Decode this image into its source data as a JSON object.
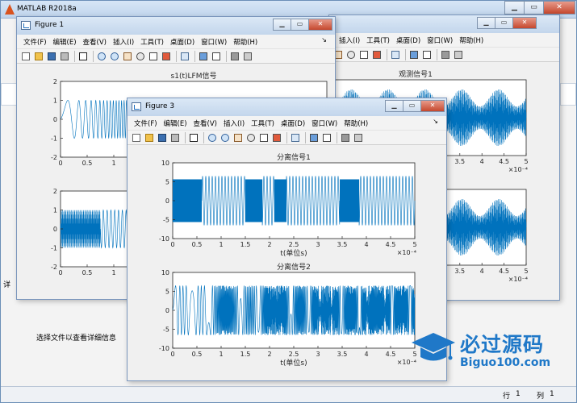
{
  "main_window": {
    "title": "MATLAB R2018a",
    "detail_hint": "选择文件以查看详细信息",
    "status_row_label": "行",
    "status_row_value": "1",
    "status_col_label": "列",
    "status_col_value": "1",
    "side_tab_label": "详"
  },
  "menu": [
    "文件(F)",
    "编辑(E)",
    "查看(V)",
    "插入(I)",
    "工具(T)",
    "桌面(D)",
    "窗口(W)",
    "帮助(H)"
  ],
  "fig2_menu_visible": [
    "插入(I)",
    "工具(T)",
    "桌面(D)",
    "窗口(W)",
    "帮助(H)"
  ],
  "toolbar_icons": [
    "new-figure-icon",
    "open-file-icon",
    "save-icon",
    "print-icon",
    "pointer-icon",
    "zoom-in-icon",
    "zoom-out-icon",
    "pan-hand-icon",
    "rotate-3d-icon",
    "data-cursor-icon",
    "brush-icon",
    "link-plot-icon",
    "colorbar-icon",
    "legend-icon",
    "hide-plot-tools-icon",
    "show-plot-tools-icon"
  ],
  "colors": {
    "line": "#0072bd",
    "accent": "#d9531e",
    "watermark": "#1f78c8"
  },
  "figures": {
    "figure1": {
      "title": "Figure 1",
      "plot1_title": "s1(t)LFM信号",
      "plot2_title": ""
    },
    "figure2": {
      "title_visible": "",
      "plot1_title": "观测信号1",
      "exp_label": "×10⁻⁴"
    },
    "figure3": {
      "title": "Figure 3",
      "plot1_title": "分离信号1",
      "plot1_xlabel": "t(单位s)",
      "plot2_title": "分离信号2",
      "plot2_xlabel": "t(单位s)",
      "exp_label": "×10⁻⁴"
    }
  },
  "chart_data": [
    {
      "type": "line",
      "title": "s1(t)LFM信号",
      "xlabel": "",
      "ylabel": "",
      "x_ticks_visible": [
        "0",
        "0.5",
        "1"
      ],
      "y_ticks": [
        "-2",
        "-1",
        "0",
        "1",
        "2"
      ],
      "xlim": [
        0,
        0.0005
      ],
      "ylim": [
        -2,
        2
      ],
      "grid": false,
      "series": [
        {
          "description_hint": "linear chirp amplitude 1",
          "amplitude": 1
        }
      ]
    },
    {
      "type": "line",
      "title": "",
      "x_ticks_visible": [
        "0",
        "0.5",
        "1"
      ],
      "y_ticks": [
        "-2",
        "-1",
        "0",
        "1",
        "2"
      ],
      "xlim": [
        0,
        0.0005
      ],
      "ylim": [
        -2,
        2
      ],
      "series": [
        {
          "amplitude": 1
        }
      ]
    },
    {
      "type": "line",
      "title": "观测信号1",
      "x_ticks_visible": [
        "3.5",
        "4",
        "4.5",
        "5"
      ],
      "exp": "×10⁻⁴",
      "xlim": [
        0,
        0.0005
      ],
      "series": [
        {
          "amplitude": 1.5
        }
      ]
    },
    {
      "type": "line",
      "title": "",
      "x_ticks_visible": [
        "3.5",
        "4",
        "4.5",
        "5"
      ],
      "exp": "×10⁻⁴",
      "xlim": [
        0,
        0.0005
      ],
      "series": [
        {
          "amplitude": 1.5
        }
      ]
    },
    {
      "type": "line",
      "title": "分离信号1",
      "xlabel": "t(单位s)",
      "x_ticks": [
        "0",
        "0.5",
        "1",
        "1.5",
        "2",
        "2.5",
        "3",
        "3.5",
        "4",
        "4.5",
        "5"
      ],
      "y_ticks": [
        "10",
        "5",
        "0",
        "-5",
        "-10"
      ],
      "xlim": [
        0,
        0.0005
      ],
      "ylim": [
        -10,
        10
      ],
      "exp": "×10⁻⁴",
      "series": [
        {
          "amplitude": 6.5
        }
      ]
    },
    {
      "type": "line",
      "title": "分离信号2",
      "xlabel": "t(单位s)",
      "x_ticks": [
        "0",
        "0.5",
        "1",
        "1.5",
        "2",
        "2.5",
        "3",
        "3.5",
        "4",
        "4.5",
        "5"
      ],
      "y_ticks": [
        "10",
        "5",
        "0",
        "-5",
        "-10"
      ],
      "xlim": [
        0,
        0.0005
      ],
      "ylim": [
        -10,
        10
      ],
      "exp": "×10⁻⁴",
      "series": [
        {
          "amplitude": 6.5
        }
      ]
    }
  ],
  "watermark": {
    "cn": "必过源码",
    "en": "Biguo100.com"
  }
}
